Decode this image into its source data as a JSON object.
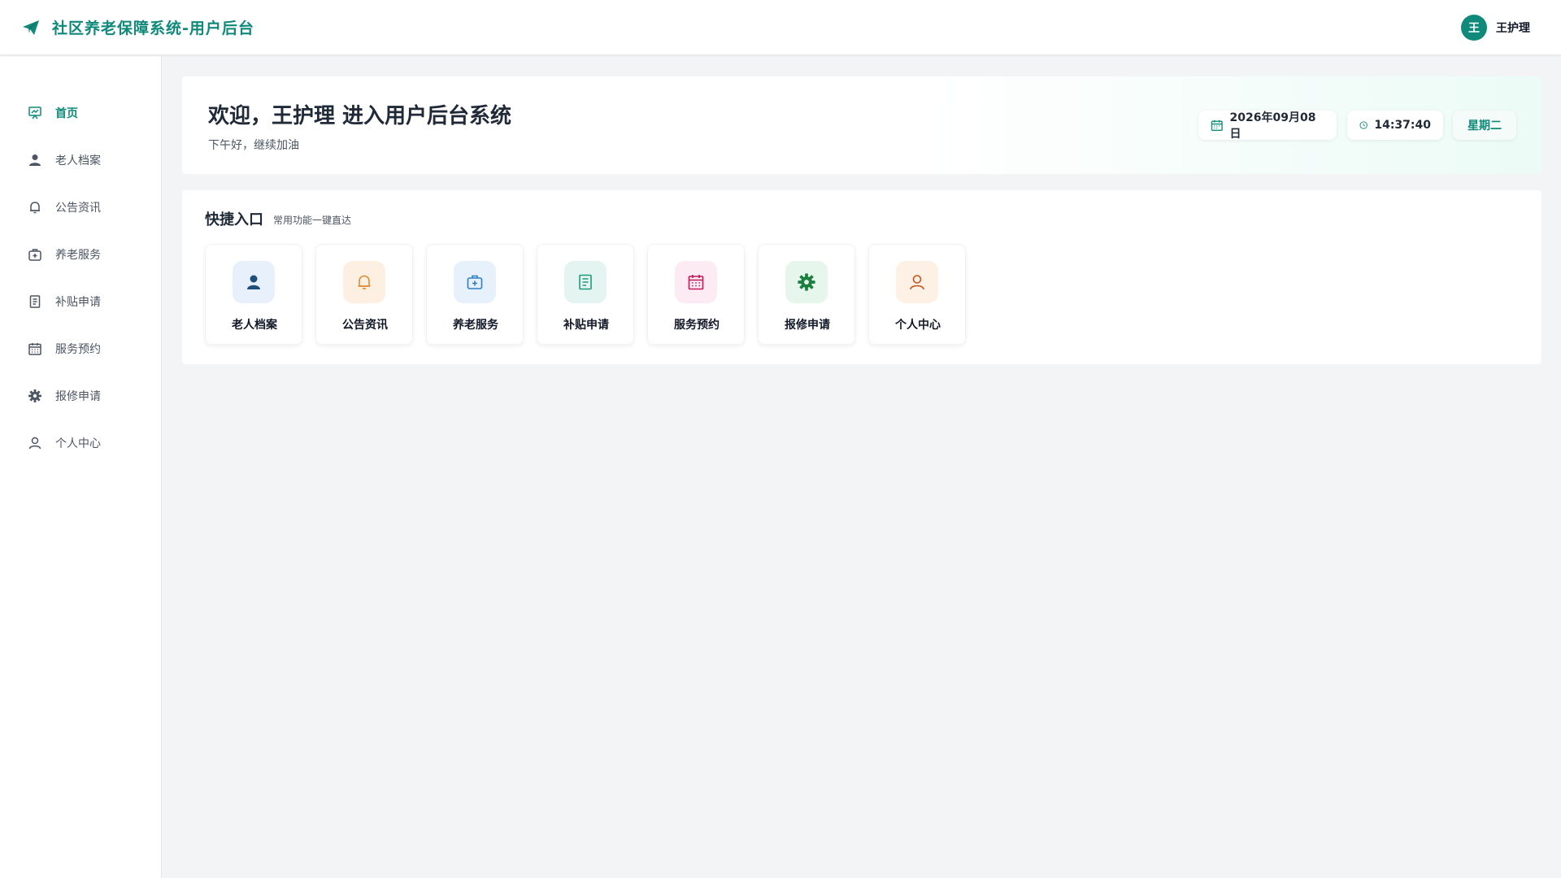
{
  "app": {
    "title": "社区养老保障系统-用户后台",
    "brand_color": "#0f8a7a"
  },
  "user": {
    "avatar_text": "王",
    "name": "王护理"
  },
  "sidebar": {
    "items": [
      {
        "label": "首页",
        "icon": "home-chart-icon",
        "active": true
      },
      {
        "label": "老人档案",
        "icon": "person-icon"
      },
      {
        "label": "公告资讯",
        "icon": "bell-icon"
      },
      {
        "label": "养老服务",
        "icon": "medical-bag-icon"
      },
      {
        "label": "补贴申请",
        "icon": "document-icon"
      },
      {
        "label": "服务预约",
        "icon": "calendar-icon"
      },
      {
        "label": "报修申请",
        "icon": "gear-icon"
      },
      {
        "label": "个人中心",
        "icon": "user-outline-icon"
      }
    ]
  },
  "welcome": {
    "title": "欢迎，王护理 进入用户后台系统",
    "subtitle": "下午好，继续加油",
    "date": "2026年09月08日",
    "time": "14:37:40",
    "weekday": "星期二"
  },
  "quick": {
    "title": "快捷入口",
    "subtitle": "常用功能一键直达",
    "tiles": [
      {
        "label": "老人档案",
        "icon": "person-icon",
        "bg": "#e8f1fb",
        "color": "#1e4f7a"
      },
      {
        "label": "公告资讯",
        "icon": "bell-icon",
        "bg": "#fdf0e3",
        "color": "#e08a2e"
      },
      {
        "label": "养老服务",
        "icon": "medical-bag-icon",
        "bg": "#e6f1fb",
        "color": "#2f7fc1"
      },
      {
        "label": "补贴申请",
        "icon": "document-icon",
        "bg": "#e4f5f1",
        "color": "#1f9a80"
      },
      {
        "label": "服务预约",
        "icon": "calendar-icon",
        "bg": "#fcebf2",
        "color": "#c2185b"
      },
      {
        "label": "报修申请",
        "icon": "gear-icon",
        "bg": "#e6f6ec",
        "color": "#1b7f3e"
      },
      {
        "label": "个人中心",
        "icon": "user-outline-icon",
        "bg": "#fdf1e6",
        "color": "#c2561c"
      }
    ]
  }
}
